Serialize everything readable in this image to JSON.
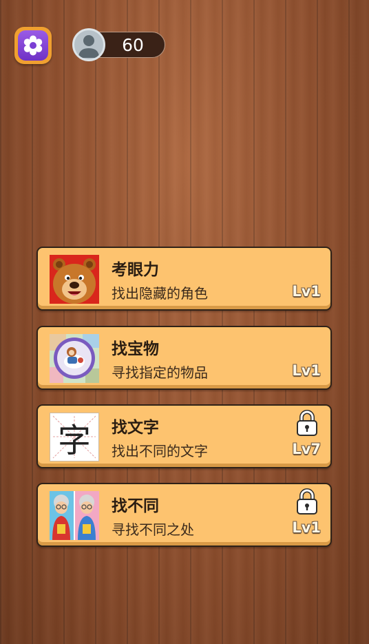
{
  "header": {
    "settings_icon": "gear-icon",
    "avatar_icon": "user-silhouette-icon",
    "coins": "60"
  },
  "modes": [
    {
      "title": "考眼力",
      "subtitle": "找出隐藏的角色",
      "level": "Lv1",
      "locked": false,
      "thumbnail": "bear-face-image"
    },
    {
      "title": "找宝物",
      "subtitle": "寻找指定的物品",
      "level": "Lv1",
      "locked": false,
      "thumbnail": "magnifier-treasure-image"
    },
    {
      "title": "找文字",
      "subtitle": "找出不同的文字",
      "level": "Lv7",
      "locked": true,
      "thumbnail": "character-zi-image",
      "thumbnail_char": "字"
    },
    {
      "title": "找不同",
      "subtitle": "寻找不同之处",
      "level": "Lv1",
      "locked": true,
      "thumbnail": "grandma-pair-image"
    }
  ],
  "colors": {
    "card_bg": "#fdc36f",
    "settings_purple": "#7b3fd4",
    "settings_border": "#f0a030",
    "wood": "#8d4e2d"
  }
}
